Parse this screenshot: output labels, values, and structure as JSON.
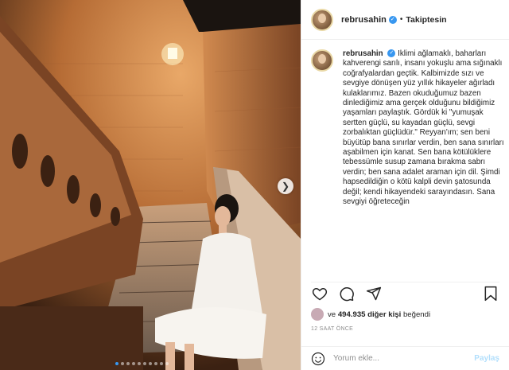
{
  "post": {
    "username": "rebrusahin",
    "separator": "•",
    "follow_label": "Takiptesin",
    "caption_username": "rebrusahin",
    "caption_text": "İklimi ağlamaklı, baharları kahverengi sarılı, insanı yokuşlu ama sığınaklı coğrafyalardan geçtik. Kalbimizde sızı ve sevgiye dönüşen yüz yıllık hikayeler ağırladı kulaklarımız. Bazen okuduğumuz bazen dinlediğimiz ama gerçek olduğunu bildiğimiz yaşamları paylaştık. Gördük ki \"yumuşak sertten güçlü, su kayadan güçlü, sevgi zorbalıktan güçlüdür.\" Reyyan'ım; sen beni büyütüp bana sınırlar verdin, ben sana sınırları aşabilmen için kanat. Sen bana kötülüklere tebessümle susup zamana bırakma sabrı verdin; ben sana adalet araman için dil. Şimdi hapsedildiğin o kötü kalpli devin şatosunda değil; kendi hikayendeki sarayındasın. Sana sevgiyi öğreteceğin",
    "likes_text": "ve",
    "likes_count": "494.935 diğer kişi",
    "likes_suffix": "beğendi",
    "timestamp": "12 SAAT ÖNCE",
    "comment_placeholder": "Yorum ekle...",
    "post_button": "Paylaş",
    "carousel_dots": 10,
    "carousel_active": 1
  },
  "icons": {
    "verified": "verified-badge-icon",
    "like": "heart-icon",
    "comment": "comment-icon",
    "share": "share-icon",
    "save": "bookmark-icon",
    "emoji": "emoji-icon",
    "next": "chevron-right-icon"
  },
  "colors": {
    "accent": "#3897f0",
    "post_disabled": "#b2dffc",
    "stone": "#c98a52"
  }
}
